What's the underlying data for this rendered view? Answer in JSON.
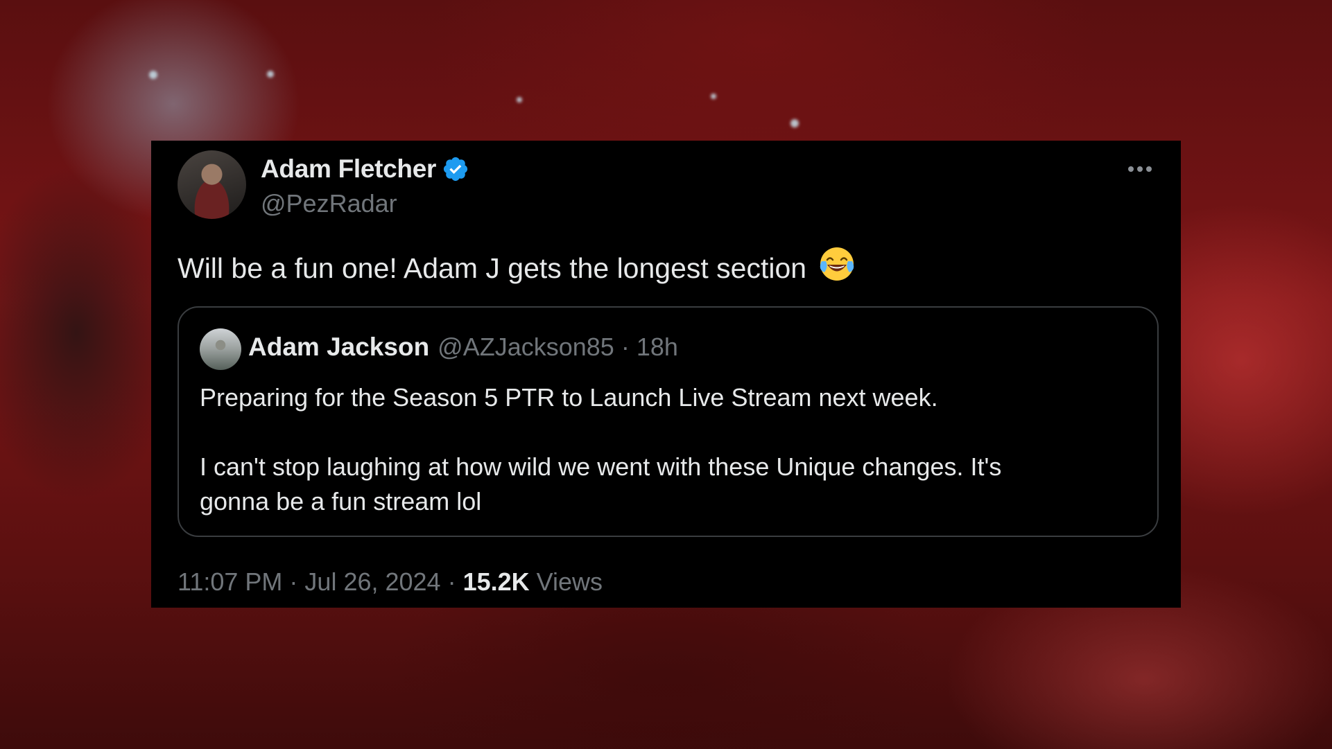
{
  "tweet": {
    "author_name": "Adam Fletcher",
    "author_handle": "@PezRadar",
    "text": "Will be a fun one! Adam J gets the longest section",
    "emoji": "face-with-tears-of-joy",
    "timestamp": "11:07 PM",
    "date": "Jul 26, 2024",
    "views_count": "15.2K",
    "views_label": "Views",
    "separator": "·"
  },
  "quoted_tweet": {
    "author_name": "Adam Jackson",
    "author_handle": "@AZJackson85",
    "age": "18h",
    "separator": "·",
    "paragraph_1": "Preparing for the Season 5 PTR to Launch Live Stream next week.",
    "paragraph_2_line_1": "I can't stop laughing at how wild we went with these Unique changes.  It's",
    "paragraph_2_line_2": "gonna be a fun stream lol"
  },
  "colors": {
    "card_bg": "#000000",
    "primary_text": "#e7e9ea",
    "secondary_text": "#71767b",
    "verified_badge": "#1d9bf0",
    "quote_border": "#3a3d40"
  },
  "icons": {
    "verified": "verified-badge-icon",
    "more": "more-options-icon"
  }
}
